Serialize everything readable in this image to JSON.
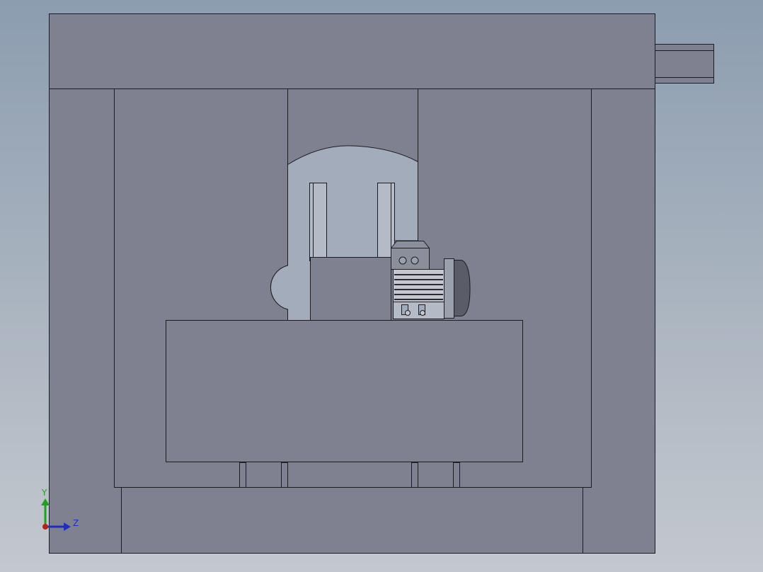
{
  "view": {
    "title": "",
    "background_top": "#8c9db0",
    "background_bottom": "#c3c8ce",
    "body_color": "#7f8191",
    "recess_color": "#a3acbb",
    "edge_color": "#1c1c22"
  },
  "triad": {
    "y_label": "Y",
    "z_label": "Z",
    "y_color": "#1fa01f",
    "z_color": "#1f2fb8",
    "origin_color": "#b81f1f",
    "icon": "coordinate-axes-icon"
  }
}
